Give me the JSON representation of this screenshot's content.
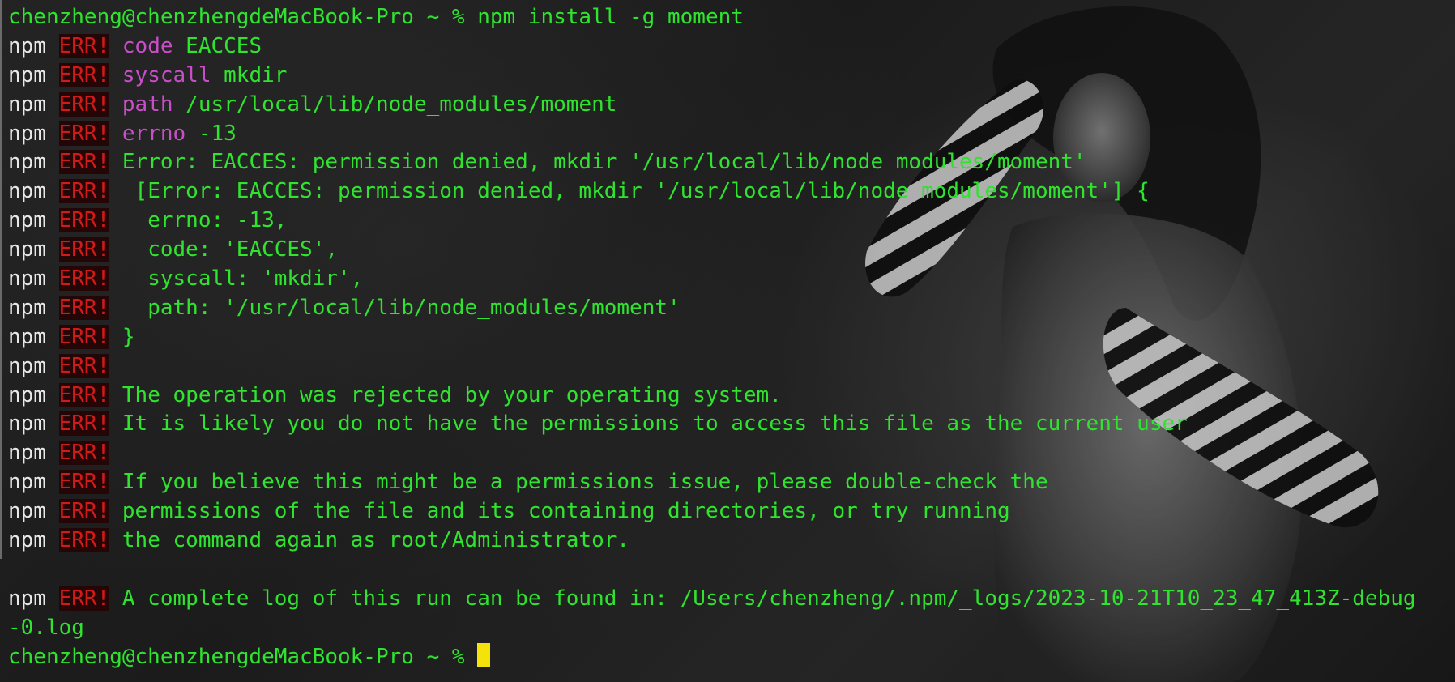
{
  "prompt": {
    "user_host": "chenzheng@chenzhengdeMacBook-Pro",
    "path": "~",
    "symbol": "%",
    "command": "npm install -g moment"
  },
  "npm_label": "npm",
  "err_label": "ERR!",
  "err_lines": [
    {
      "key": "code",
      "text": " EACCES"
    },
    {
      "key": "syscall",
      "text": " mkdir"
    },
    {
      "key": "path",
      "text": " /usr/local/lib/node_modules/moment"
    },
    {
      "key": "errno",
      "text": " -13"
    },
    {
      "key": "",
      "text": "Error: EACCES: permission denied, mkdir '/usr/local/lib/node_modules/moment'"
    },
    {
      "key": "",
      "text": " [Error: EACCES: permission denied, mkdir '/usr/local/lib/node_modules/moment'] {"
    },
    {
      "key": "",
      "text": "  errno: -13,"
    },
    {
      "key": "",
      "text": "  code: 'EACCES',"
    },
    {
      "key": "",
      "text": "  syscall: 'mkdir',"
    },
    {
      "key": "",
      "text": "  path: '/usr/local/lib/node_modules/moment'"
    },
    {
      "key": "",
      "text": "}"
    },
    {
      "key": "",
      "text": ""
    },
    {
      "key": "",
      "text": "The operation was rejected by your operating system."
    },
    {
      "key": "",
      "text": "It is likely you do not have the permissions to access this file as the current user"
    },
    {
      "key": "",
      "text": ""
    },
    {
      "key": "",
      "text": "If you believe this might be a permissions issue, please double-check the"
    },
    {
      "key": "",
      "text": "permissions of the file and its containing directories, or try running"
    },
    {
      "key": "",
      "text": "the command again as root/Administrator."
    }
  ],
  "log_line": {
    "text": "A complete log of this run can be found in: /Users/chenzheng/.npm/_logs/2023-10-21T10_23_47_413Z-debug",
    "continuation": "-0.log"
  },
  "final_prompt": {
    "user_host": "chenzheng@chenzhengdeMacBook-Pro",
    "path": "~",
    "symbol": "%"
  },
  "colors": {
    "output_green": "#2fe32f",
    "key_magenta": "#c94ec9",
    "err_red": "#d11a1a",
    "npm_white": "#e8e8e8",
    "cursor_yellow": "#f5e20a"
  }
}
